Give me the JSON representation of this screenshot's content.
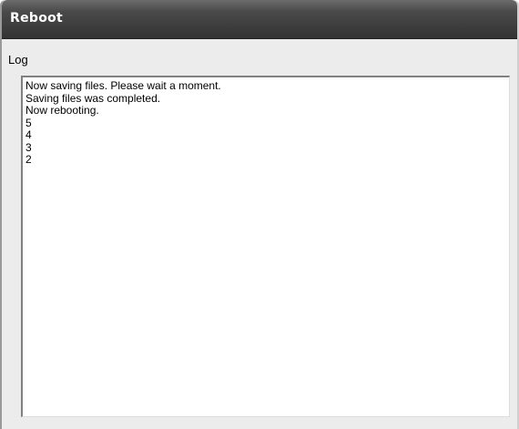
{
  "window": {
    "title": "Reboot"
  },
  "log": {
    "label": "Log",
    "lines": [
      "Now saving files. Please wait a moment.",
      "Saving files was completed.",
      "Now rebooting.",
      "5",
      "4",
      "3",
      "2"
    ]
  }
}
